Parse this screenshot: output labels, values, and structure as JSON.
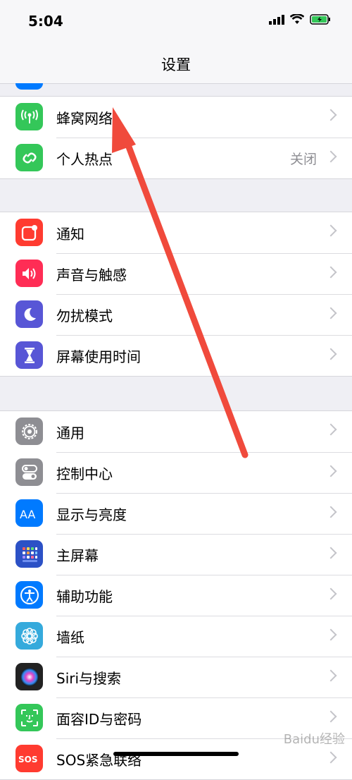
{
  "status": {
    "time": "5:04"
  },
  "nav": {
    "title": "设置"
  },
  "groups": [
    [
      {
        "label": "蜂窝网络",
        "icon": "cellular-icon",
        "color": "#34c759"
      },
      {
        "label": "个人热点",
        "value": "关闭",
        "icon": "hotspot-icon",
        "color": "#34c759"
      }
    ],
    [
      {
        "label": "通知",
        "icon": "notifications-icon",
        "color": "#ff3b30"
      },
      {
        "label": "声音与触感",
        "icon": "sound-icon",
        "color": "#ff2d55"
      },
      {
        "label": "勿扰模式",
        "icon": "moon-icon",
        "color": "#5856d6"
      },
      {
        "label": "屏幕使用时间",
        "icon": "hourglass-icon",
        "color": "#5856d6"
      }
    ],
    [
      {
        "label": "通用",
        "icon": "gear-icon",
        "color": "#8e8e93"
      },
      {
        "label": "控制中心",
        "icon": "control-center-icon",
        "color": "#8e8e93"
      },
      {
        "label": "显示与亮度",
        "icon": "display-icon",
        "color": "#007aff"
      },
      {
        "label": "主屏幕",
        "icon": "home-screen-icon",
        "color": "#2c51c6"
      },
      {
        "label": "辅助功能",
        "icon": "accessibility-icon",
        "color": "#007aff"
      },
      {
        "label": "墙纸",
        "icon": "wallpaper-icon",
        "color": "#35aadc"
      },
      {
        "label": "Siri与搜索",
        "icon": "siri-icon",
        "color": "#222222"
      },
      {
        "label": "面容ID与密码",
        "icon": "face-id-icon",
        "color": "#34c759"
      },
      {
        "label": "SOS紧急联络",
        "icon": "sos-icon",
        "color": "#ff3b30"
      }
    ]
  ],
  "watermark": "Baidu经验",
  "annotation": {
    "arrow_color": "#f04a3c"
  }
}
